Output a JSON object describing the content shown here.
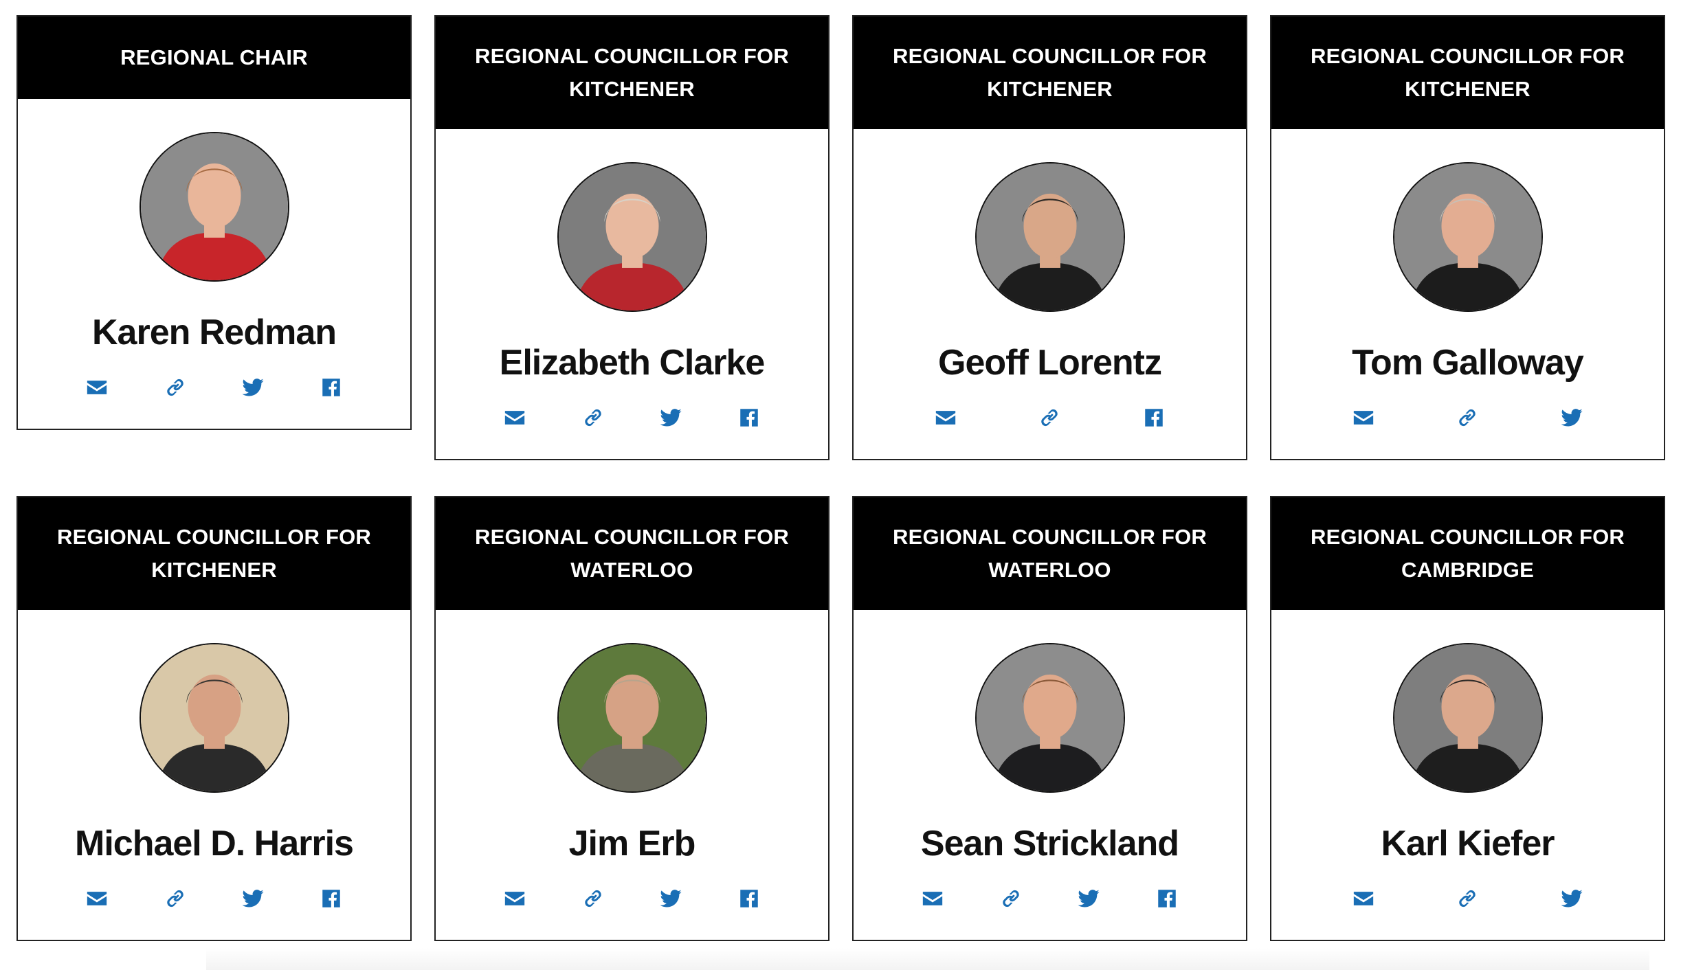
{
  "councillors": [
    {
      "role": "REGIONAL CHAIR",
      "name": "Karen Redman",
      "icons": [
        "email-icon",
        "link-icon",
        "twitter-icon",
        "facebook-icon"
      ],
      "photo": {
        "bg": "#8c8c8c",
        "hair": "#a56a42",
        "skin": "#e9b69a",
        "clothes": "#c8252a"
      }
    },
    {
      "role": "REGIONAL COUNCILLOR FOR KITCHENER",
      "name": "Elizabeth Clarke",
      "icons": [
        "email-icon",
        "link-icon",
        "twitter-icon",
        "facebook-icon"
      ],
      "photo": {
        "bg": "#7d7d7d",
        "hair": "#d8d2c8",
        "skin": "#e8b99f",
        "clothes": "#b8262d"
      }
    },
    {
      "role": "REGIONAL COUNCILLOR FOR KITCHENER",
      "name": "Geoff Lorentz",
      "icons": [
        "email-icon",
        "link-icon",
        "facebook-icon"
      ],
      "photo": {
        "bg": "#8a8a8a",
        "hair": "#2e2a26",
        "skin": "#d9a788",
        "clothes": "#1d1d1d"
      }
    },
    {
      "role": "REGIONAL COUNCILLOR FOR KITCHENER",
      "name": "Tom Galloway",
      "icons": [
        "email-icon",
        "link-icon",
        "twitter-icon"
      ],
      "photo": {
        "bg": "#8b8b8b",
        "hair": "#c7c0b8",
        "skin": "#e3ad92",
        "clothes": "#1c1c1c"
      }
    },
    {
      "role": "REGIONAL COUNCILLOR FOR KITCHENER",
      "name": "Michael D. Harris",
      "icons": [
        "email-icon",
        "link-icon",
        "twitter-icon",
        "facebook-icon"
      ],
      "photo": {
        "bg": "#d9c8a8",
        "hair": "#3b3733",
        "skin": "#d7a184",
        "clothes": "#2a2a2a"
      }
    },
    {
      "role": "REGIONAL COUNCILLOR FOR WATERLOO",
      "name": "Jim Erb",
      "icons": [
        "email-icon",
        "link-icon",
        "twitter-icon",
        "facebook-icon"
      ],
      "photo": {
        "bg": "#5e7a3c",
        "hair": "#b7a48c",
        "skin": "#d6a285",
        "clothes": "#6a6a5e"
      }
    },
    {
      "role": "REGIONAL COUNCILLOR FOR WATERLOO",
      "name": "Sean Strickland",
      "icons": [
        "email-icon",
        "link-icon",
        "twitter-icon",
        "facebook-icon"
      ],
      "photo": {
        "bg": "#8d8d8d",
        "hair": "#8a5a3a",
        "skin": "#e0a98b",
        "clothes": "#1d1d1f"
      }
    },
    {
      "role": "REGIONAL COUNCILLOR FOR CAMBRIDGE",
      "name": "Karl Kiefer",
      "icons": [
        "email-icon",
        "link-icon",
        "twitter-icon"
      ],
      "photo": {
        "bg": "#7e7e7e",
        "hair": "#2f2b28",
        "skin": "#dca88c",
        "clothes": "#1e1e1e"
      }
    }
  ],
  "colors": {
    "accent": "#1a6eb5",
    "header_bg": "#000000",
    "header_text": "#ffffff",
    "name_text": "#111111"
  }
}
